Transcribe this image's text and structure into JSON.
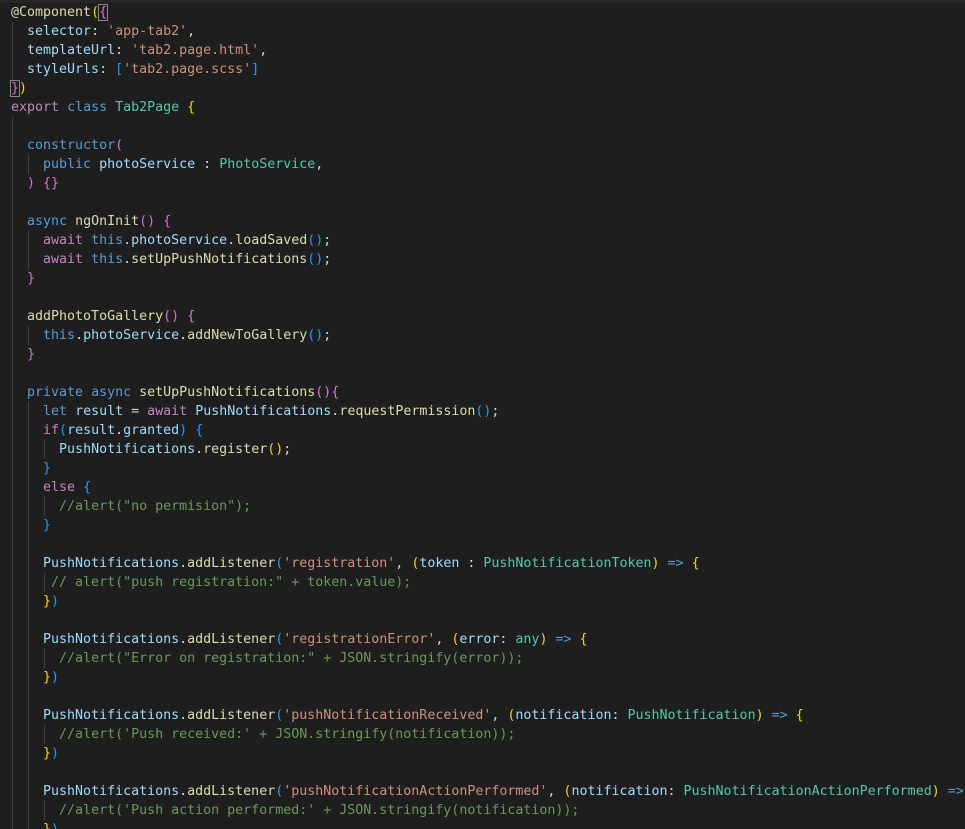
{
  "theme": {
    "background": "#1e1e1e",
    "default_text": "#d4d4d4",
    "keyword_blue": "#569cd6",
    "control_purple": "#c586c0",
    "type_teal": "#4ec9b0",
    "variable_light_blue": "#9cdcfe",
    "function_yellow": "#dcdcaa",
    "string_orange": "#ce9178",
    "comment_green": "#6a9955",
    "bracket_gold": "#ffd700",
    "bracket_orchid": "#da70d6",
    "bracket_sky": "#179fff"
  },
  "code_lines": [
    {
      "tokens": [
        {
          "t": "@Component",
          "c": "t-yellow"
        },
        {
          "t": "(",
          "c": "t-gold"
        },
        {
          "t": "{",
          "c": "t-orchid"
        }
      ]
    },
    {
      "tokens": [
        {
          "t": "  "
        },
        {
          "t": "selector",
          "c": "t-lblue"
        },
        {
          "t": ": "
        },
        {
          "t": "'app-tab2'",
          "c": "t-str"
        },
        {
          "t": ","
        }
      ]
    },
    {
      "tokens": [
        {
          "t": "  "
        },
        {
          "t": "templateUrl",
          "c": "t-lblue"
        },
        {
          "t": ": "
        },
        {
          "t": "'tab2.page.html'",
          "c": "t-str"
        },
        {
          "t": ","
        }
      ]
    },
    {
      "tokens": [
        {
          "t": "  "
        },
        {
          "t": "styleUrls",
          "c": "t-lblue"
        },
        {
          "t": ": "
        },
        {
          "t": "[",
          "c": "t-sky"
        },
        {
          "t": "'tab2.page.scss'",
          "c": "t-str"
        },
        {
          "t": "]",
          "c": "t-sky"
        }
      ]
    },
    {
      "tokens": [
        {
          "t": "}",
          "c": "t-orchid"
        },
        {
          "t": ")",
          "c": "t-gold"
        }
      ]
    },
    {
      "tokens": [
        {
          "t": "export",
          "c": "t-purple"
        },
        {
          "t": " "
        },
        {
          "t": "class",
          "c": "t-blue"
        },
        {
          "t": " "
        },
        {
          "t": "Tab2Page",
          "c": "t-teal"
        },
        {
          "t": " "
        },
        {
          "t": "{",
          "c": "t-gold"
        }
      ]
    },
    {
      "tokens": [
        {
          "t": ""
        }
      ]
    },
    {
      "tokens": [
        {
          "t": "  "
        },
        {
          "t": "constructor",
          "c": "t-blue"
        },
        {
          "t": "(",
          "c": "t-orchid"
        }
      ]
    },
    {
      "tokens": [
        {
          "t": "    "
        },
        {
          "t": "public",
          "c": "t-blue"
        },
        {
          "t": " "
        },
        {
          "t": "photoService",
          "c": "t-lblue"
        },
        {
          "t": " : "
        },
        {
          "t": "PhotoService",
          "c": "t-teal"
        },
        {
          "t": ","
        }
      ]
    },
    {
      "tokens": [
        {
          "t": "  "
        },
        {
          "t": ")",
          "c": "t-orchid"
        },
        {
          "t": " "
        },
        {
          "t": "{}",
          "c": "t-orchid"
        }
      ]
    },
    {
      "tokens": [
        {
          "t": ""
        }
      ]
    },
    {
      "tokens": [
        {
          "t": "  "
        },
        {
          "t": "async",
          "c": "t-blue"
        },
        {
          "t": " "
        },
        {
          "t": "ngOnInit",
          "c": "t-yellow"
        },
        {
          "t": "()",
          "c": "t-orchid"
        },
        {
          "t": " "
        },
        {
          "t": "{",
          "c": "t-orchid"
        }
      ]
    },
    {
      "tokens": [
        {
          "t": "    "
        },
        {
          "t": "await",
          "c": "t-purple"
        },
        {
          "t": " "
        },
        {
          "t": "this",
          "c": "t-blue"
        },
        {
          "t": "."
        },
        {
          "t": "photoService",
          "c": "t-lblue"
        },
        {
          "t": "."
        },
        {
          "t": "loadSaved",
          "c": "t-yellow"
        },
        {
          "t": "()",
          "c": "t-sky"
        },
        {
          "t": ";"
        }
      ]
    },
    {
      "tokens": [
        {
          "t": "    "
        },
        {
          "t": "await",
          "c": "t-purple"
        },
        {
          "t": " "
        },
        {
          "t": "this",
          "c": "t-blue"
        },
        {
          "t": "."
        },
        {
          "t": "setUpPushNotifications",
          "c": "t-yellow"
        },
        {
          "t": "()",
          "c": "t-sky"
        },
        {
          "t": ";"
        }
      ]
    },
    {
      "tokens": [
        {
          "t": "  "
        },
        {
          "t": "}",
          "c": "t-orchid"
        }
      ]
    },
    {
      "tokens": [
        {
          "t": ""
        }
      ]
    },
    {
      "tokens": [
        {
          "t": "  "
        },
        {
          "t": "addPhotoToGallery",
          "c": "t-yellow"
        },
        {
          "t": "()",
          "c": "t-orchid"
        },
        {
          "t": " "
        },
        {
          "t": "{",
          "c": "t-orchid"
        }
      ]
    },
    {
      "tokens": [
        {
          "t": "    "
        },
        {
          "t": "this",
          "c": "t-blue"
        },
        {
          "t": "."
        },
        {
          "t": "photoService",
          "c": "t-lblue"
        },
        {
          "t": "."
        },
        {
          "t": "addNewToGallery",
          "c": "t-yellow"
        },
        {
          "t": "()",
          "c": "t-sky"
        },
        {
          "t": ";"
        }
      ]
    },
    {
      "tokens": [
        {
          "t": "  "
        },
        {
          "t": "}",
          "c": "t-orchid"
        }
      ]
    },
    {
      "tokens": [
        {
          "t": ""
        }
      ]
    },
    {
      "tokens": [
        {
          "t": "  "
        },
        {
          "t": "private",
          "c": "t-blue"
        },
        {
          "t": " "
        },
        {
          "t": "async",
          "c": "t-blue"
        },
        {
          "t": " "
        },
        {
          "t": "setUpPushNotifications",
          "c": "t-yellow"
        },
        {
          "t": "()",
          "c": "t-orchid"
        },
        {
          "t": "{",
          "c": "t-orchid"
        }
      ]
    },
    {
      "tokens": [
        {
          "t": "    "
        },
        {
          "t": "let",
          "c": "t-blue"
        },
        {
          "t": " "
        },
        {
          "t": "result",
          "c": "t-lblue"
        },
        {
          "t": " = "
        },
        {
          "t": "await",
          "c": "t-purple"
        },
        {
          "t": " "
        },
        {
          "t": "PushNotifications",
          "c": "t-lblue"
        },
        {
          "t": "."
        },
        {
          "t": "requestPermission",
          "c": "t-yellow"
        },
        {
          "t": "()",
          "c": "t-sky"
        },
        {
          "t": ";"
        }
      ]
    },
    {
      "tokens": [
        {
          "t": "    "
        },
        {
          "t": "if",
          "c": "t-purple"
        },
        {
          "t": "(",
          "c": "t-sky"
        },
        {
          "t": "result",
          "c": "t-lblue"
        },
        {
          "t": "."
        },
        {
          "t": "granted",
          "c": "t-lblue"
        },
        {
          "t": ")",
          "c": "t-sky"
        },
        {
          "t": " "
        },
        {
          "t": "{",
          "c": "t-sky"
        }
      ]
    },
    {
      "tokens": [
        {
          "t": "      "
        },
        {
          "t": "PushNotifications",
          "c": "t-lblue"
        },
        {
          "t": "."
        },
        {
          "t": "register",
          "c": "t-yellow"
        },
        {
          "t": "()",
          "c": "t-gold"
        },
        {
          "t": ";"
        }
      ]
    },
    {
      "tokens": [
        {
          "t": "    "
        },
        {
          "t": "}",
          "c": "t-sky"
        }
      ]
    },
    {
      "tokens": [
        {
          "t": "    "
        },
        {
          "t": "else",
          "c": "t-purple"
        },
        {
          "t": " "
        },
        {
          "t": "{",
          "c": "t-sky"
        }
      ]
    },
    {
      "tokens": [
        {
          "t": "      "
        },
        {
          "t": "//alert(\"no permision\");",
          "c": "t-cmt"
        }
      ]
    },
    {
      "tokens": [
        {
          "t": "    "
        },
        {
          "t": "}",
          "c": "t-sky"
        }
      ]
    },
    {
      "tokens": [
        {
          "t": ""
        }
      ]
    },
    {
      "tokens": [
        {
          "t": "    "
        },
        {
          "t": "PushNotifications",
          "c": "t-lblue"
        },
        {
          "t": "."
        },
        {
          "t": "addListener",
          "c": "t-yellow"
        },
        {
          "t": "(",
          "c": "t-sky"
        },
        {
          "t": "'registration'",
          "c": "t-str"
        },
        {
          "t": ", "
        },
        {
          "t": "(",
          "c": "t-gold"
        },
        {
          "t": "token",
          "c": "t-lblue"
        },
        {
          "t": " : "
        },
        {
          "t": "PushNotificationToken",
          "c": "t-teal"
        },
        {
          "t": ")",
          "c": "t-gold"
        },
        {
          "t": " "
        },
        {
          "t": "=>",
          "c": "t-blue"
        },
        {
          "t": " "
        },
        {
          "t": "{",
          "c": "t-gold"
        }
      ]
    },
    {
      "tokens": [
        {
          "t": "     "
        },
        {
          "t": "// alert(\"push registration:\" + token.value);",
          "c": "t-cmt"
        }
      ]
    },
    {
      "tokens": [
        {
          "t": "    "
        },
        {
          "t": "}",
          "c": "t-gold"
        },
        {
          "t": ")",
          "c": "t-sky"
        }
      ]
    },
    {
      "tokens": [
        {
          "t": ""
        }
      ]
    },
    {
      "tokens": [
        {
          "t": "    "
        },
        {
          "t": "PushNotifications",
          "c": "t-lblue"
        },
        {
          "t": "."
        },
        {
          "t": "addListener",
          "c": "t-yellow"
        },
        {
          "t": "(",
          "c": "t-sky"
        },
        {
          "t": "'registrationError'",
          "c": "t-str"
        },
        {
          "t": ", "
        },
        {
          "t": "(",
          "c": "t-gold"
        },
        {
          "t": "error",
          "c": "t-lblue"
        },
        {
          "t": ": "
        },
        {
          "t": "any",
          "c": "t-teal"
        },
        {
          "t": ")",
          "c": "t-gold"
        },
        {
          "t": " "
        },
        {
          "t": "=>",
          "c": "t-blue"
        },
        {
          "t": " "
        },
        {
          "t": "{",
          "c": "t-gold"
        }
      ]
    },
    {
      "tokens": [
        {
          "t": "      "
        },
        {
          "t": "//alert(\"Error on registration:\" + JSON.stringify(error));",
          "c": "t-cmt"
        }
      ]
    },
    {
      "tokens": [
        {
          "t": "    "
        },
        {
          "t": "}",
          "c": "t-gold"
        },
        {
          "t": ")",
          "c": "t-sky"
        }
      ]
    },
    {
      "tokens": [
        {
          "t": ""
        }
      ]
    },
    {
      "tokens": [
        {
          "t": "    "
        },
        {
          "t": "PushNotifications",
          "c": "t-lblue"
        },
        {
          "t": "."
        },
        {
          "t": "addListener",
          "c": "t-yellow"
        },
        {
          "t": "(",
          "c": "t-sky"
        },
        {
          "t": "'pushNotificationReceived'",
          "c": "t-str"
        },
        {
          "t": ", "
        },
        {
          "t": "(",
          "c": "t-gold"
        },
        {
          "t": "notification",
          "c": "t-lblue"
        },
        {
          "t": ": "
        },
        {
          "t": "PushNotification",
          "c": "t-teal"
        },
        {
          "t": ")",
          "c": "t-gold"
        },
        {
          "t": " "
        },
        {
          "t": "=>",
          "c": "t-blue"
        },
        {
          "t": " "
        },
        {
          "t": "{",
          "c": "t-gold"
        }
      ]
    },
    {
      "tokens": [
        {
          "t": "      "
        },
        {
          "t": "//alert('Push received:' + JSON.stringify(notification));",
          "c": "t-cmt"
        }
      ]
    },
    {
      "tokens": [
        {
          "t": "    "
        },
        {
          "t": "}",
          "c": "t-gold"
        },
        {
          "t": ")",
          "c": "t-sky"
        }
      ]
    },
    {
      "tokens": [
        {
          "t": ""
        }
      ]
    },
    {
      "tokens": [
        {
          "t": "    "
        },
        {
          "t": "PushNotifications",
          "c": "t-lblue"
        },
        {
          "t": "."
        },
        {
          "t": "addListener",
          "c": "t-yellow"
        },
        {
          "t": "(",
          "c": "t-sky"
        },
        {
          "t": "'pushNotificationActionPerformed'",
          "c": "t-str"
        },
        {
          "t": ", "
        },
        {
          "t": "(",
          "c": "t-gold"
        },
        {
          "t": "notification",
          "c": "t-lblue"
        },
        {
          "t": ": "
        },
        {
          "t": "PushNotificationActionPerformed",
          "c": "t-teal"
        },
        {
          "t": ")",
          "c": "t-gold"
        },
        {
          "t": " "
        },
        {
          "t": "=>",
          "c": "t-blue"
        },
        {
          "t": " "
        },
        {
          "t": "{",
          "c": "t-gold"
        }
      ]
    },
    {
      "tokens": [
        {
          "t": "      "
        },
        {
          "t": "//alert('Push action performed:' + JSON.stringify(notification));",
          "c": "t-cmt"
        }
      ]
    },
    {
      "tokens": [
        {
          "t": "    "
        },
        {
          "t": "}",
          "c": "t-gold"
        },
        {
          "t": ")",
          "c": "t-sky"
        }
      ]
    }
  ]
}
